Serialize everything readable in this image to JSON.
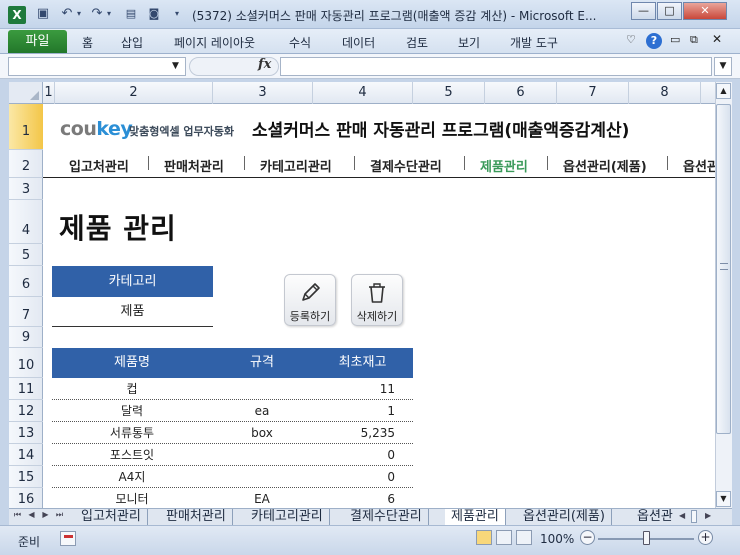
{
  "window": {
    "title": "(5372) 소셜커머스 판매 자동관리 프로그램(매출액 증감 계산) - Microsoft E...",
    "app_icon": "X",
    "minimize": "—",
    "maximize": "□",
    "close": "✕"
  },
  "ribbon": {
    "file": "파일",
    "tabs": [
      "홈",
      "삽입",
      "페이지 레이아웃",
      "수식",
      "데이터",
      "검토",
      "보기",
      "개발 도구"
    ],
    "help": "?"
  },
  "formula_bar": {
    "fx": "fx"
  },
  "columns": [
    "1",
    "2",
    "3",
    "4",
    "5",
    "6",
    "7",
    "8"
  ],
  "rows": [
    "1",
    "2",
    "3",
    "4",
    "5",
    "6",
    "7",
    "9",
    "10",
    "11",
    "12",
    "13",
    "14",
    "15",
    "16"
  ],
  "sheet": {
    "logo": {
      "brand_a": "cou",
      "brand_b": "key",
      "tagline": "맞춤형엑셀 업무자동화"
    },
    "heading": "소셜커머스 판매 자동관리 프로그램(매출액증감계산)",
    "nav": [
      "입고처관리",
      "판매처관리",
      "카테고리관리",
      "결제수단관리",
      "제품관리",
      "옵션관리(제품)",
      "옵션관"
    ],
    "nav_active": "제품관리",
    "page_title": "제품 관리",
    "category": {
      "label": "카테고리",
      "value": "제품"
    },
    "buttons": {
      "register": "등록하기",
      "delete": "삭제하기"
    },
    "table": {
      "headers": [
        "제품명",
        "규격",
        "최초재고"
      ],
      "rows": [
        [
          "컵",
          "",
          "11"
        ],
        [
          "달력",
          "ea",
          "1"
        ],
        [
          "서류통투",
          "box",
          "5,235"
        ],
        [
          "포스트잇",
          "",
          "0"
        ],
        [
          "A4지",
          "",
          "0"
        ],
        [
          "모니터",
          "EA",
          "6"
        ]
      ]
    }
  },
  "sheet_tabs": [
    "입고처관리",
    "판매처관리",
    "카테고리관리",
    "결제수단관리",
    "제품관리",
    "옵션관리(제품)",
    "옵션관"
  ],
  "active_sheet_tab": "제품관리",
  "status": {
    "ready": "준비",
    "zoom": "100%"
  }
}
